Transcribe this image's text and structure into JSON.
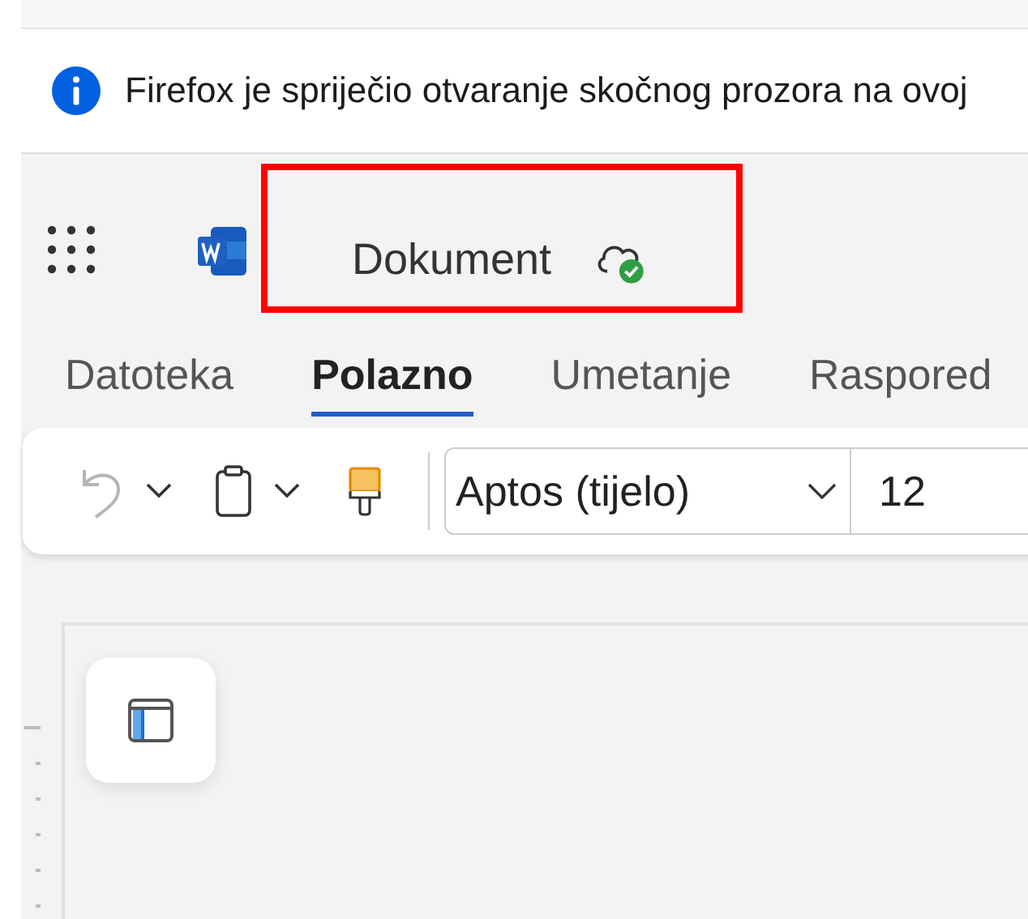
{
  "notification": {
    "text": "Firefox je spriječio otvaranje skočnog prozora na ovoj"
  },
  "header": {
    "document_title": "Dokument",
    "highlighted": true
  },
  "tabs": [
    {
      "label": "Datoteka",
      "selected": false
    },
    {
      "label": "Polazno",
      "selected": true
    },
    {
      "label": "Umetanje",
      "selected": false
    },
    {
      "label": "Raspored",
      "selected": false
    }
  ],
  "toolbar": {
    "font": "Aptos (tijelo)",
    "size": "12"
  }
}
